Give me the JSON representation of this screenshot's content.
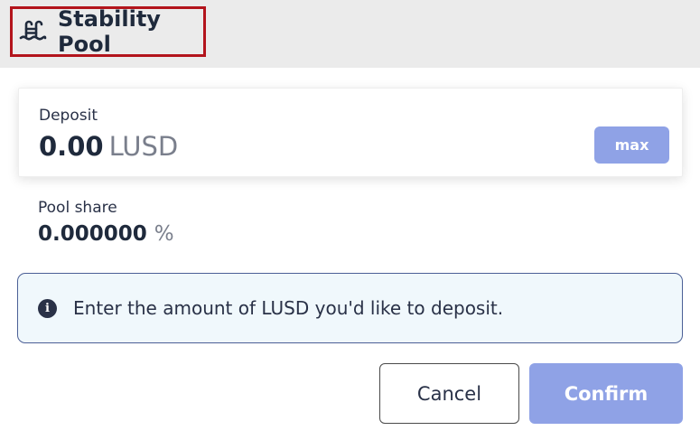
{
  "header": {
    "title": "Stability Pool",
    "icon": "swimming-pool-icon"
  },
  "deposit": {
    "label": "Deposit",
    "amount": "0.00",
    "unit": "LUSD",
    "max_label": "max"
  },
  "pool_share": {
    "label": "Pool share",
    "value": "0.000000",
    "unit": "%"
  },
  "info": {
    "icon": "info-icon",
    "message": "Enter the amount of LUSD you'd like to deposit."
  },
  "actions": {
    "cancel_label": "Cancel",
    "confirm_label": "Confirm"
  },
  "colors": {
    "header_bg": "#ebebeb",
    "title_outline": "#b3141c",
    "accent": "#8fa2e6",
    "text_dark": "#293147",
    "info_bg": "#f0f8fc",
    "info_border": "#4b5f96"
  }
}
